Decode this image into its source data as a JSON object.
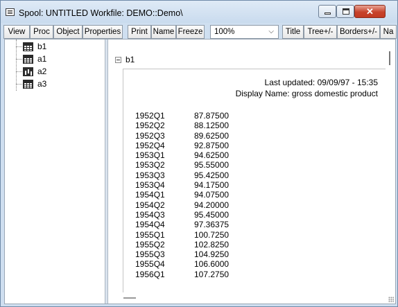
{
  "window": {
    "title": "Spool: UNTITLED   Workfile: DEMO::Demo\\",
    "controls": {
      "minimize_icon": "minimize-icon",
      "maximize_icon": "maximize-icon",
      "close_icon": "close-icon",
      "close_glyph": "✕"
    }
  },
  "toolbar": {
    "buttons": [
      "View",
      "Proc",
      "Object",
      "Properties",
      "Print",
      "Name",
      "Freeze"
    ],
    "zoom": {
      "value": "100%",
      "chevron": "⌵"
    },
    "right_buttons": [
      "Title",
      "Tree+/-",
      "Borders+/-",
      "Na"
    ]
  },
  "tree": {
    "items": [
      {
        "label": "b1",
        "icon": "table-icon"
      },
      {
        "label": "a1",
        "icon": "table-icon"
      },
      {
        "label": "a2",
        "icon": "graph-icon"
      },
      {
        "label": "a3",
        "icon": "table-icon"
      }
    ]
  },
  "main": {
    "section_title": "b1",
    "last_updated": "Last updated: 09/09/97 - 15:35",
    "display_name": "Display Name: gross domestic product",
    "rows": [
      {
        "period": "1952Q1",
        "value": "87.87500"
      },
      {
        "period": "1952Q2",
        "value": "88.12500"
      },
      {
        "period": "1952Q3",
        "value": "89.62500"
      },
      {
        "period": "1952Q4",
        "value": "92.87500"
      },
      {
        "period": "1953Q1",
        "value": "94.62500"
      },
      {
        "period": "1953Q2",
        "value": "95.55000"
      },
      {
        "period": "1953Q3",
        "value": "95.42500"
      },
      {
        "period": "1953Q4",
        "value": "94.17500"
      },
      {
        "period": "1954Q1",
        "value": "94.07500"
      },
      {
        "period": "1954Q2",
        "value": "94.20000"
      },
      {
        "period": "1954Q3",
        "value": "95.45000"
      },
      {
        "period": "1954Q4",
        "value": "97.36375"
      },
      {
        "period": "1955Q1",
        "value": "100.7250"
      },
      {
        "period": "1955Q2",
        "value": "102.8250"
      },
      {
        "period": "1955Q3",
        "value": "104.9250"
      },
      {
        "period": "1955Q4",
        "value": "106.6000"
      },
      {
        "period": "1956Q1",
        "value": "107.2750"
      }
    ]
  },
  "colors": {
    "frame": "#cfdff0",
    "close": "#c7432c"
  }
}
